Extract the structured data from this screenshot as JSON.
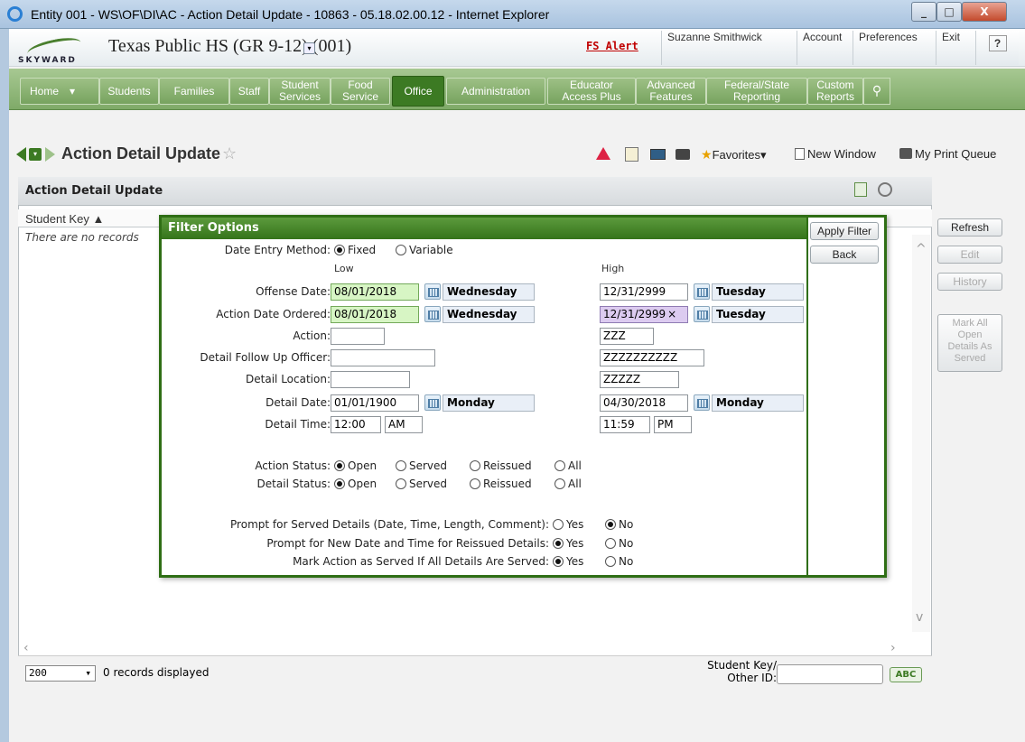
{
  "window": {
    "title": "Entity 001 - WS\\OF\\DI\\AC - Action Detail Update - 10863 - 05.18.02.00.12 - Internet Explorer",
    "minimize": "_",
    "maximize": "□",
    "close": "X"
  },
  "header": {
    "logo_text": "SKYWARD",
    "school": "Texas Public HS (GR 9-12) (001)",
    "school_dropdown": "▾",
    "fs_alert": "FS Alert",
    "user": "Suzanne Smithwick",
    "account": "Account",
    "preferences": "Preferences",
    "exit": "Exit",
    "help": "?"
  },
  "nav": {
    "home": "Home",
    "home_dropdown": "▾",
    "students": "Students",
    "families": "Families",
    "staff": "Staff",
    "student_services": "Student Services",
    "food_service": "Food Service",
    "office": "Office",
    "administration": "Administration",
    "educator_access_plus": "Educator Access Plus",
    "advanced_features": "Advanced Features",
    "federal_state_reporting": "Federal/State Reporting",
    "custom_reports": "Custom Reports",
    "search_glyph": "⚲"
  },
  "toolbar": {
    "page_title": "Action Detail Update",
    "favorites": "Favorites",
    "new_window": "New Window",
    "my_print_queue": "My Print Queue"
  },
  "grid": {
    "panel_title": "Action Detail Update",
    "column_header": "Student Key ▲",
    "empty_text": "There are no records",
    "page_size": "200",
    "page_size_arrow": "▾",
    "record_count": "0 records displayed",
    "search_label": "Student Key/ Other ID:",
    "search_value": "",
    "abc_label": "ABC"
  },
  "side_buttons": {
    "refresh": "Refresh",
    "edit": "Edit",
    "history": "History",
    "mark_all": "Mark All Open Details As Served"
  },
  "filter": {
    "title": "Filter Options",
    "apply_filter": "Apply Filter",
    "back": "Back",
    "date_entry_method_label": "Date Entry Method:",
    "date_entry_fixed": "Fixed",
    "date_entry_variable": "Variable",
    "low_label": "Low",
    "high_label": "High",
    "offense_date_label": "Offense Date:",
    "offense_low": "08/01/2018",
    "offense_low_day": "Wednesday",
    "offense_high": "12/31/2999",
    "offense_high_day": "Tuesday",
    "action_date_label": "Action Date Ordered:",
    "action_low": "08/01/2018",
    "action_low_day": "Wednesday",
    "action_high": "12/31/2999",
    "action_high_clear": "×",
    "action_high_day": "Tuesday",
    "action_label": "Action:",
    "action_low_value": "",
    "action_high_value": "ZZZ",
    "officer_label": "Detail Follow Up Officer:",
    "officer_low": "",
    "officer_high": "ZZZZZZZZZZ",
    "location_label": "Detail Location:",
    "location_low": "",
    "location_high": "ZZZZZ",
    "detail_date_label": "Detail Date:",
    "detail_date_low": "01/01/1900",
    "detail_date_low_day": "Monday",
    "detail_date_high": "04/30/2018",
    "detail_date_high_day": "Monday",
    "detail_time_label": "Detail Time:",
    "detail_time_low": "12:00",
    "detail_time_low_ampm": "AM",
    "detail_time_high": "11:59",
    "detail_time_high_ampm": "PM",
    "action_status_label": "Action Status:",
    "detail_status_label": "Detail Status:",
    "status_open": "Open",
    "status_served": "Served",
    "status_reissued": "Reissued",
    "status_all": "All",
    "prompt_served_label": "Prompt for Served Details (Date, Time, Length, Comment):",
    "prompt_reissued_label": "Prompt for New Date and Time for Reissued Details:",
    "mark_served_label": "Mark Action as Served If All Details Are Served:",
    "yes": "Yes",
    "no": "No"
  }
}
